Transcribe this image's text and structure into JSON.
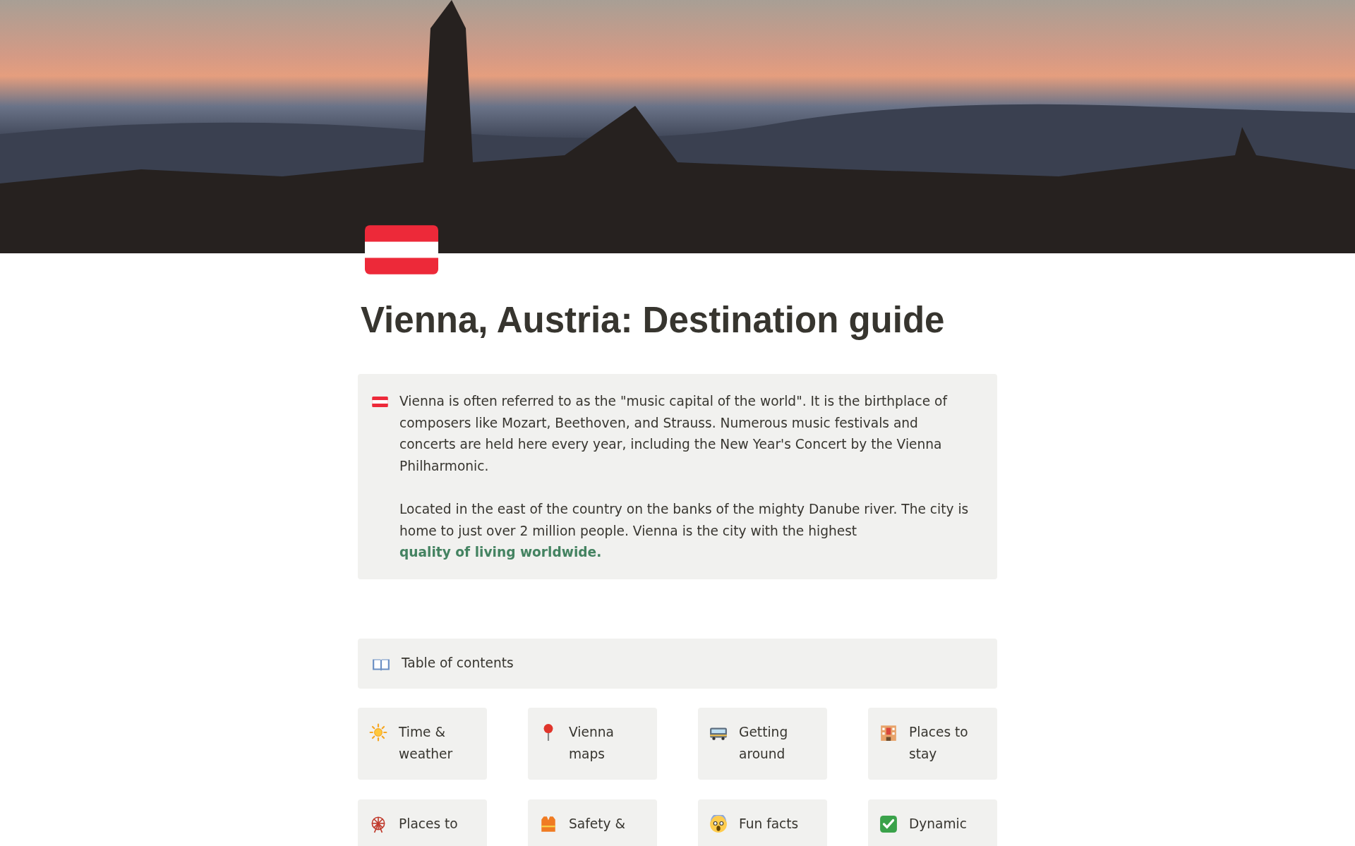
{
  "cover": {
    "kind": "photo"
  },
  "title": "Vienna, Austria: Destination guide",
  "callout": {
    "paragraphs": [
      {
        "text": "Vienna is often referred to as the \"music capital of the world\". It is the birthplace of composers like Mozart, Beethoven, and Strauss. Numerous music festivals and concerts are held here every year, including the New Year's Concert by the Vienna Philharmonic."
      },
      {
        "text": "Located in the east of the country on the banks of the mighty Danube river. The city is home to just over 2 million people. Vienna is the city with the highest ",
        "link": "quality of living worldwide."
      }
    ]
  },
  "toc": {
    "label": "Table of contents"
  },
  "cards": [
    {
      "kind": "sun",
      "label": "Time & weather"
    },
    {
      "kind": "pin",
      "label": "Vienna maps"
    },
    {
      "kind": "tram",
      "label": "Getting around"
    },
    {
      "kind": "hotel",
      "label": "Places to stay"
    },
    {
      "kind": "wheel",
      "label": "Places to"
    },
    {
      "kind": "vest",
      "label": "Safety &"
    },
    {
      "kind": "face",
      "label": "Fun facts"
    },
    {
      "kind": "check",
      "label": "Dynamic"
    }
  ]
}
